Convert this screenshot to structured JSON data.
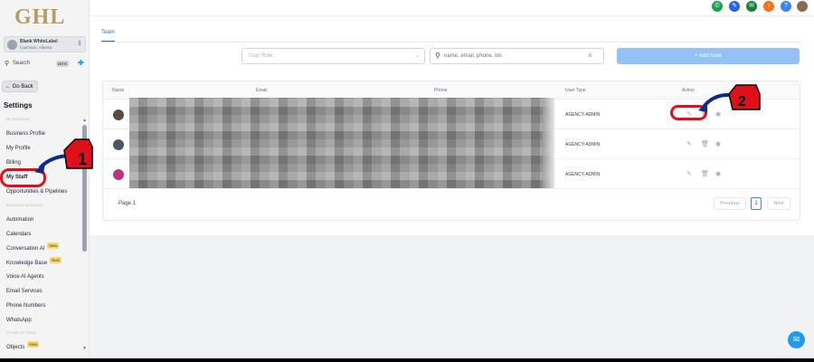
{
  "brand": {
    "logo_text": "GHL"
  },
  "account": {
    "name": "Blank WhiteLabel",
    "location": "Canmore, Alberta"
  },
  "sidebar_search": {
    "label": "Search",
    "shortcut": "ctrl K"
  },
  "go_back": "← Go Back",
  "settings_title": "Settings",
  "sections": {
    "my_business": "MY BUSINESS",
    "business_services": "BUSINESS SERVICES",
    "other_settings": "OTHER SETTINGS"
  },
  "nav": {
    "business_profile": "Business Profile",
    "my_profile": "My Profile",
    "billing": "Billing",
    "my_staff": "My Staff",
    "opportunities": "Opportunities & Pipelines",
    "automation": "Automation",
    "calendars": "Calendars",
    "conversation_ai": "Conversation AI",
    "knowledge_base": "Knowledge Base",
    "voice_ai": "Voice AI Agents",
    "email_services": "Email Services",
    "phone_numbers": "Phone Numbers",
    "whatsapp": "WhatsApp",
    "objects": "Objects"
  },
  "badges": {
    "new": "New"
  },
  "tabs": {
    "team": "Team"
  },
  "filters": {
    "role_placeholder": "User Role",
    "search_placeholder": "name, email, phone, ids",
    "add_user": "+ Add User"
  },
  "table": {
    "headers": {
      "name": "Name",
      "email": "Email",
      "phone": "Phone",
      "user_type": "User Type",
      "action": "Action"
    },
    "rows": [
      {
        "user_type": "AGENCY-ADMIN"
      },
      {
        "user_type": "AGENCY-ADMIN"
      },
      {
        "user_type": "AGENCY-ADMIN"
      }
    ]
  },
  "pagination": {
    "page_label": "Page 1",
    "previous": "Previous",
    "current": "1",
    "next": "Next"
  },
  "annotations": {
    "step1": "1",
    "step2": "2"
  },
  "colors": {
    "annotation_red": "#e0101a",
    "annotation_arrow": "#0b2a8a",
    "primary": "#1e6fd0",
    "add_user_bg": "#93c0f5",
    "logo_gold": "#b89a66"
  },
  "icons": {
    "topbar": [
      "phone-icon",
      "megaphone-icon",
      "announcement-icon",
      "notification-icon",
      "help-icon"
    ],
    "row_actions": [
      "edit-icon",
      "delete-icon",
      "view-icon"
    ]
  }
}
